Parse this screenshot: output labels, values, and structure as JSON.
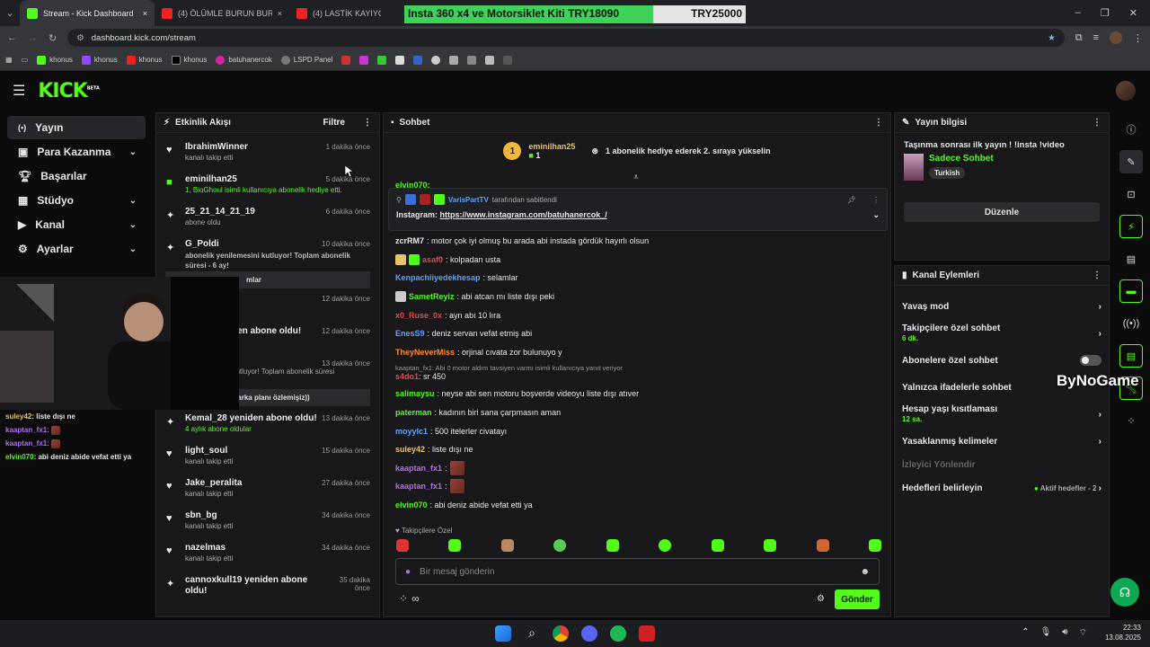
{
  "browser": {
    "tabs": [
      {
        "label": "Stream - Kick Dashboard",
        "color": "#53fc18"
      },
      {
        "label": "(4) ÖLÜMLE BURUN BURUNA!",
        "color": "#e22"
      },
      {
        "label": "(4) LASTİK KAYIYOR MU",
        "color": "#e22"
      }
    ],
    "url": "dashboard.kick.com/stream",
    "bookmarks": [
      "khonus",
      "khonus",
      "khonus",
      "khonus",
      "batuhanercok",
      "LSPD Panel"
    ]
  },
  "promo": {
    "text": "Insta 360 x4 ve Motorsiklet Kiti",
    "amount": "TRY18090",
    "goal": "TRY25000"
  },
  "brand": {
    "name": "KICK",
    "sup": "BETA",
    "accent": "#53fc18"
  },
  "nav": [
    {
      "label": "Yayın",
      "icon": "broadcast-icon",
      "active": true
    },
    {
      "label": "Para Kazanma",
      "icon": "money-icon",
      "chev": "⌄"
    },
    {
      "label": "Başarılar",
      "icon": "trophy-icon"
    },
    {
      "label": "Stüdyo",
      "icon": "studio-icon",
      "chev": "⌄"
    },
    {
      "label": "Kanal",
      "icon": "channel-icon",
      "chev": "⌄"
    },
    {
      "label": "Ayarlar",
      "icon": "settings-icon",
      "chev": "⌄"
    }
  ],
  "activity": {
    "title": "Etkinlik Akışı",
    "filter": "Filtre",
    "items": [
      {
        "name": "IbrahimWinner",
        "sub": "kanalı takip etti",
        "time": "1 dakika önce",
        "icon": "♥"
      },
      {
        "name": "eminilhan25",
        "sub": "1, BioGhoul isimli kullanıcıya abonelik hediye etti.",
        "time": "5 dakika önce",
        "icon": "■"
      },
      {
        "name": "25_21_14_21_19",
        "sub": "abone oldu",
        "time": "6 dakika önce",
        "icon": "✦"
      },
      {
        "name": "G_Poldi",
        "sub": "abonelik yenilemesini kutluyor! Toplam abonelik süresi - 6 ay!",
        "time": "10 dakika önce",
        "icon": "✦"
      }
    ],
    "box1": "mlar",
    "times_hidden": [
      "12 dakika önce",
      "12 dakika önce",
      "13 dakika önce"
    ],
    "hidden_subs": [
      "yeniden abone oldu!",
      "oldular",
      "lesini kutluyor! Toplam abonelik süresi"
    ],
    "box2": "iyi yayınlar abimm (arka planı özlemişiz))",
    "items2": [
      {
        "name": "Kemal_28 yeniden abone oldu!",
        "sub": "4 aylık abone oldular",
        "time": "13 dakika önce",
        "icon": "✦"
      },
      {
        "name": "light_soul",
        "sub": "kanalı takip etti",
        "time": "15 dakika önce",
        "icon": "♥"
      },
      {
        "name": "Jake_peralita",
        "sub": "kanalı takip etti",
        "time": "27 dakika önce",
        "icon": "♥"
      },
      {
        "name": "sbn_bg",
        "sub": "kanalı takip etti",
        "time": "34 dakika önce",
        "icon": "♥"
      },
      {
        "name": "nazelmas",
        "sub": "kanalı takip etti",
        "time": "34 dakika önce",
        "icon": "♥"
      },
      {
        "name": "cannoxkull19 yeniden abone oldu!",
        "sub": "",
        "time": "35 dakika önce",
        "icon": "✦"
      }
    ]
  },
  "overlay_chat": [
    {
      "user": "suley42",
      "color": "#e8c36a",
      "text": ": liste dışı ne"
    },
    {
      "user": "kaaptan_fx1",
      "color": "#b36cf0",
      "text": ":"
    },
    {
      "user": "kaaptan_fx1",
      "color": "#b36cf0",
      "text": ":"
    },
    {
      "user": "elvin070",
      "color": "#53fc18",
      "text": ": abi deniz abide vefat etti ya"
    }
  ],
  "chat": {
    "title": "Sohbet",
    "gift_user": "eminilhan25",
    "gift_count": "1",
    "gift_rank": "1",
    "gift_msg": "1 abonelik hediye ederek 2. sıraya yükselin",
    "pinned_by": "VarisPartTV",
    "pinned_suffix": "tarafından sabitlendi",
    "pinned_label": "Instagram:",
    "pinned_link": "https://www.instagram.com/batuhanercok_/",
    "top_partial": "elvin070:",
    "messages": [
      {
        "user": "zcrRM7",
        "color": "#e8e8e8",
        "text": ": motor çok iyi olmuş bu arada abi instada gördük hayırlı olsun"
      },
      {
        "user": "asaf0",
        "color": "#e04848",
        "text": ": kolpadan usta"
      },
      {
        "user": "Kenpachiiyedekhesap",
        "color": "#5aa0ff",
        "text": ": selamlar"
      },
      {
        "user": "SametReyiz",
        "color": "#53fc18",
        "text": ": abi atcan mı liste dışı peki"
      },
      {
        "user": "x0_Ruse_0x",
        "color": "#e04848",
        "text": ": ayn abı 10 lıra"
      },
      {
        "user": "EnesS9",
        "color": "#5aa0ff",
        "text": ": deniz servan vefat etmiş abi"
      },
      {
        "user": "TheyNeverMiss",
        "color": "#ff8a2a",
        "text": ": orjinal cıvata zor bulunuyo y"
      },
      {
        "user": "s4do1",
        "color": "#e04848",
        "text": ": sr 450",
        "reply": "kaaptan_fx1: Abi 0 motor aldım tavsiyen varmı isimli kullanıcıya yanıt veriyor"
      },
      {
        "user": "salimaysu",
        "color": "#53fc18",
        "text": ": neyse abi sen motoru boşverde videoyu liste dışı atıver"
      },
      {
        "user": "paterman",
        "color": "#53fc18",
        "text": ": kadının biri sana çarpmasın aman"
      },
      {
        "user": "moyylc1",
        "color": "#5aa0ff",
        "text": ": 500 itelerler civatayı"
      },
      {
        "user": "suley42",
        "color": "#e8c36a",
        "text": ": liste dışı ne"
      },
      {
        "user": "kaaptan_fx1",
        "color": "#b36cf0",
        "text": ":",
        "emote": true
      },
      {
        "user": "kaaptan_fx1",
        "color": "#b36cf0",
        "text": ":",
        "emote": true
      },
      {
        "user": "elvin070",
        "color": "#53fc18",
        "text": ": abi deniz abide vefat etti ya"
      }
    ],
    "followers_only": "Takipçilere Özel",
    "placeholder": "Bir mesaj gönderin",
    "send": "Gönder"
  },
  "stream_info": {
    "title_h": "Yayın bilgisi",
    "stream_title": "Taşınma sonrası ilk yayın ! !insta !video",
    "category": "Sadece Sohbet",
    "tag": "Turkish",
    "edit": "Düzenle"
  },
  "channel_actions": {
    "title": "Kanal Eylemleri",
    "rows": [
      {
        "label": "Yavaş mod",
        "sub": ""
      },
      {
        "label": "Takipçilere özel sohbet",
        "sub": "6 dk."
      },
      {
        "label": "Abonelere özel sohbet",
        "sub": ""
      },
      {
        "label": "Yalnızca ifadelerle sohbet",
        "sub": ""
      },
      {
        "label": "Hesap yaşı kısıtlaması",
        "sub": "12 sa."
      },
      {
        "label": "Yasaklanmış kelimeler",
        "sub": ""
      },
      {
        "label": "İzleyici Yönlendir",
        "sub": ""
      },
      {
        "label": "Hedefleri belirleyin",
        "sub": "Aktif hedefler - 2"
      }
    ]
  },
  "watermark": "ByNoGame",
  "clock": {
    "time": "22:33",
    "date": "13.08.2025"
  }
}
